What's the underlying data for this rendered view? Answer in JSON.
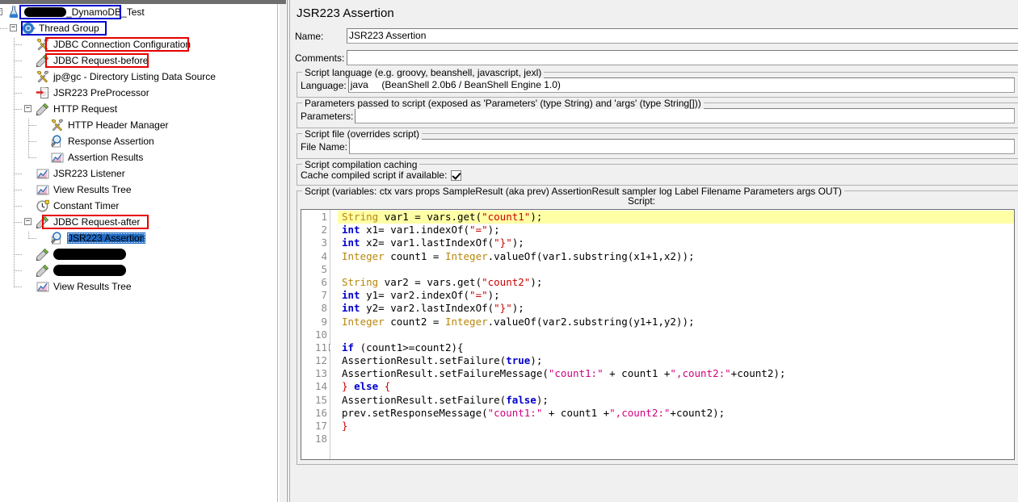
{
  "window": {
    "title": "JSR223 Assertion"
  },
  "tree": {
    "nodes": [
      {
        "id": "test-plan",
        "label": "_DynamoDB_Test",
        "icon": "test-plan-icon",
        "depth": 0,
        "handle": "minus",
        "annotation": "blue",
        "redacted_prefix": true
      },
      {
        "id": "thread-group",
        "label": "Thread Group",
        "icon": "thread-group-icon",
        "depth": 1,
        "handle": "minus",
        "annotation": "blue"
      },
      {
        "id": "jdbc-conn-config",
        "label": "JDBC Connection Configuration",
        "icon": "config-element-icon",
        "depth": 2,
        "handle": "none",
        "annotation": "red"
      },
      {
        "id": "jdbc-req-before",
        "label": "JDBC Request-before",
        "icon": "sampler-icon",
        "depth": 2,
        "handle": "none",
        "annotation": "red"
      },
      {
        "id": "dir-listing",
        "label": "jp@gc - Directory Listing Data Source",
        "icon": "config-element-icon",
        "depth": 2,
        "handle": "none",
        "annotation": "none"
      },
      {
        "id": "jsr223-pre",
        "label": "JSR223 PreProcessor",
        "icon": "preprocessor-icon",
        "depth": 2,
        "handle": "none",
        "annotation": "none"
      },
      {
        "id": "http-request",
        "label": "HTTP Request",
        "icon": "sampler-icon",
        "depth": 2,
        "handle": "minus",
        "annotation": "none"
      },
      {
        "id": "http-header-mgr",
        "label": "HTTP Header Manager",
        "icon": "config-element-icon",
        "depth": 3,
        "handle": "none",
        "annotation": "none"
      },
      {
        "id": "response-assert",
        "label": "Response Assertion",
        "icon": "assertion-icon",
        "depth": 3,
        "handle": "none",
        "annotation": "none"
      },
      {
        "id": "assertion-results",
        "label": "Assertion Results",
        "icon": "listener-icon",
        "depth": 3,
        "handle": "none",
        "annotation": "none"
      },
      {
        "id": "jsr223-listener",
        "label": "JSR223 Listener",
        "icon": "listener-icon",
        "depth": 2,
        "handle": "none",
        "annotation": "none"
      },
      {
        "id": "view-results-1",
        "label": "View Results Tree",
        "icon": "listener-icon",
        "depth": 2,
        "handle": "none",
        "annotation": "none"
      },
      {
        "id": "constant-timer",
        "label": "Constant Timer",
        "icon": "timer-icon",
        "depth": 2,
        "handle": "none",
        "annotation": "none"
      },
      {
        "id": "jdbc-req-after",
        "label": "JDBC Request-after",
        "icon": "sampler-icon",
        "depth": 2,
        "handle": "minus",
        "annotation": "red"
      },
      {
        "id": "jsr223-assertion",
        "label": "JSR223 Assertion",
        "icon": "assertion-icon",
        "depth": 3,
        "handle": "none",
        "annotation": "none",
        "selected": true
      },
      {
        "id": "redacted-1",
        "label": "",
        "icon": "sampler-icon",
        "depth": 2,
        "handle": "none",
        "annotation": "none",
        "redacted": true
      },
      {
        "id": "redacted-2",
        "label": "",
        "icon": "sampler-icon",
        "depth": 2,
        "handle": "none",
        "annotation": "none",
        "redacted": true
      },
      {
        "id": "view-results-2",
        "label": "View Results Tree",
        "icon": "listener-icon",
        "depth": 2,
        "handle": "none",
        "annotation": "none"
      }
    ]
  },
  "form": {
    "name_label": "Name:",
    "name_value": "JSR223 Assertion",
    "comments_label": "Comments:",
    "comments_value": "",
    "script_language_group": "Script language (e.g. groovy, beanshell, javascript, jexl)",
    "language_label": "Language:",
    "language_value": "java     (BeanShell 2.0b6 / BeanShell Engine 1.0)",
    "parameters_group": "Parameters passed to script (exposed as 'Parameters' (type String) and 'args' (type String[]))",
    "parameters_label": "Parameters:",
    "parameters_value": "",
    "script_file_group": "Script file (overrides script)",
    "file_name_label": "File Name:",
    "file_name_value": "",
    "caching_group": "Script compilation caching",
    "cache_label": "Cache compiled script if available:",
    "cache_checked": true,
    "script_group": "Script (variables: ctx vars props SampleResult (aka prev) AssertionResult sampler log Label Filename Parameters args OUT)",
    "script_caption": "Script:"
  },
  "editor": {
    "total_lines": 18,
    "highlighted_line": 1,
    "fold_marker_line": 11,
    "line_numbers": [
      "1",
      "2",
      "3",
      "4",
      "5",
      "6",
      "7",
      "8",
      "9",
      "10",
      "11",
      "12",
      "13",
      "14",
      "15",
      "16",
      "17",
      "18"
    ],
    "lines": [
      {
        "n": 1,
        "tokens": [
          {
            "t": "String",
            "c": "t-type"
          },
          {
            "t": " var1 = vars.get(",
            "c": "t-plain"
          },
          {
            "t": "\"count1\"",
            "c": "t-str"
          },
          {
            "t": ");",
            "c": "t-plain"
          }
        ]
      },
      {
        "n": 2,
        "tokens": [
          {
            "t": "int",
            "c": "t-kw"
          },
          {
            "t": " x1= var1.indexOf(",
            "c": "t-plain"
          },
          {
            "t": "\"=\"",
            "c": "t-str"
          },
          {
            "t": ");",
            "c": "t-plain"
          }
        ]
      },
      {
        "n": 3,
        "tokens": [
          {
            "t": "int",
            "c": "t-kw"
          },
          {
            "t": " x2= var1.lastIndexOf(",
            "c": "t-plain"
          },
          {
            "t": "\"}\"",
            "c": "t-str"
          },
          {
            "t": ");",
            "c": "t-plain"
          }
        ]
      },
      {
        "n": 4,
        "tokens": [
          {
            "t": "Integer",
            "c": "t-type"
          },
          {
            "t": " count1 = ",
            "c": "t-plain"
          },
          {
            "t": "Integer",
            "c": "t-type"
          },
          {
            "t": ".valueOf(var1.substring(x1+1,x2));",
            "c": "t-plain"
          }
        ]
      },
      {
        "n": 5,
        "tokens": []
      },
      {
        "n": 6,
        "tokens": [
          {
            "t": "String",
            "c": "t-type"
          },
          {
            "t": " var2 = vars.get(",
            "c": "t-plain"
          },
          {
            "t": "\"count2\"",
            "c": "t-str"
          },
          {
            "t": ");",
            "c": "t-plain"
          }
        ]
      },
      {
        "n": 7,
        "tokens": [
          {
            "t": "int",
            "c": "t-kw"
          },
          {
            "t": " y1= var2.indexOf(",
            "c": "t-plain"
          },
          {
            "t": "\"=\"",
            "c": "t-str"
          },
          {
            "t": ");",
            "c": "t-plain"
          }
        ]
      },
      {
        "n": 8,
        "tokens": [
          {
            "t": "int",
            "c": "t-kw"
          },
          {
            "t": " y2= var2.lastIndexOf(",
            "c": "t-plain"
          },
          {
            "t": "\"}\"",
            "c": "t-str"
          },
          {
            "t": ");",
            "c": "t-plain"
          }
        ]
      },
      {
        "n": 9,
        "tokens": [
          {
            "t": "Integer",
            "c": "t-type"
          },
          {
            "t": " count2 = ",
            "c": "t-plain"
          },
          {
            "t": "Integer",
            "c": "t-type"
          },
          {
            "t": ".valueOf(var2.substring(y1+1,y2));",
            "c": "t-plain"
          }
        ]
      },
      {
        "n": 10,
        "tokens": []
      },
      {
        "n": 11,
        "tokens": [
          {
            "t": "if",
            "c": "t-kw"
          },
          {
            "t": " (count1>=count2){",
            "c": "t-plain"
          }
        ]
      },
      {
        "n": 12,
        "tokens": [
          {
            "t": "AssertionResult.setFailure(",
            "c": "t-plain"
          },
          {
            "t": "true",
            "c": "t-kw"
          },
          {
            "t": ");",
            "c": "t-plain"
          }
        ]
      },
      {
        "n": 13,
        "tokens": [
          {
            "t": "AssertionResult.setFailureMessage(",
            "c": "t-plain"
          },
          {
            "t": "\"count1:\"",
            "c": "t-str2"
          },
          {
            "t": " + count1 +",
            "c": "t-plain"
          },
          {
            "t": "\",count2:\"",
            "c": "t-str2"
          },
          {
            "t": "+count2);",
            "c": "t-plain"
          }
        ]
      },
      {
        "n": 14,
        "tokens": [
          {
            "t": "}",
            "c": "t-brace"
          },
          {
            "t": " ",
            "c": "t-plain"
          },
          {
            "t": "else",
            "c": "t-kw"
          },
          {
            "t": " ",
            "c": "t-plain"
          },
          {
            "t": "{",
            "c": "t-brace"
          }
        ]
      },
      {
        "n": 15,
        "tokens": [
          {
            "t": "AssertionResult.setFailure(",
            "c": "t-plain"
          },
          {
            "t": "false",
            "c": "t-kw"
          },
          {
            "t": ");",
            "c": "t-plain"
          }
        ]
      },
      {
        "n": 16,
        "tokens": [
          {
            "t": "prev.setResponseMessage(",
            "c": "t-plain"
          },
          {
            "t": "\"count1:\"",
            "c": "t-str2"
          },
          {
            "t": " + count1 +",
            "c": "t-plain"
          },
          {
            "t": "\",count2:\"",
            "c": "t-str2"
          },
          {
            "t": "+count2);",
            "c": "t-plain"
          }
        ]
      },
      {
        "n": 17,
        "tokens": [
          {
            "t": "}",
            "c": "t-brace"
          }
        ]
      },
      {
        "n": 18,
        "tokens": []
      }
    ]
  },
  "colors": {
    "annotation_red": "#e60000",
    "annotation_blue": "#0000d0",
    "selection_blue": "#1f6bc4",
    "highlight_yellow": "#ffffa6",
    "panel_bg": "#f0f0f0"
  }
}
